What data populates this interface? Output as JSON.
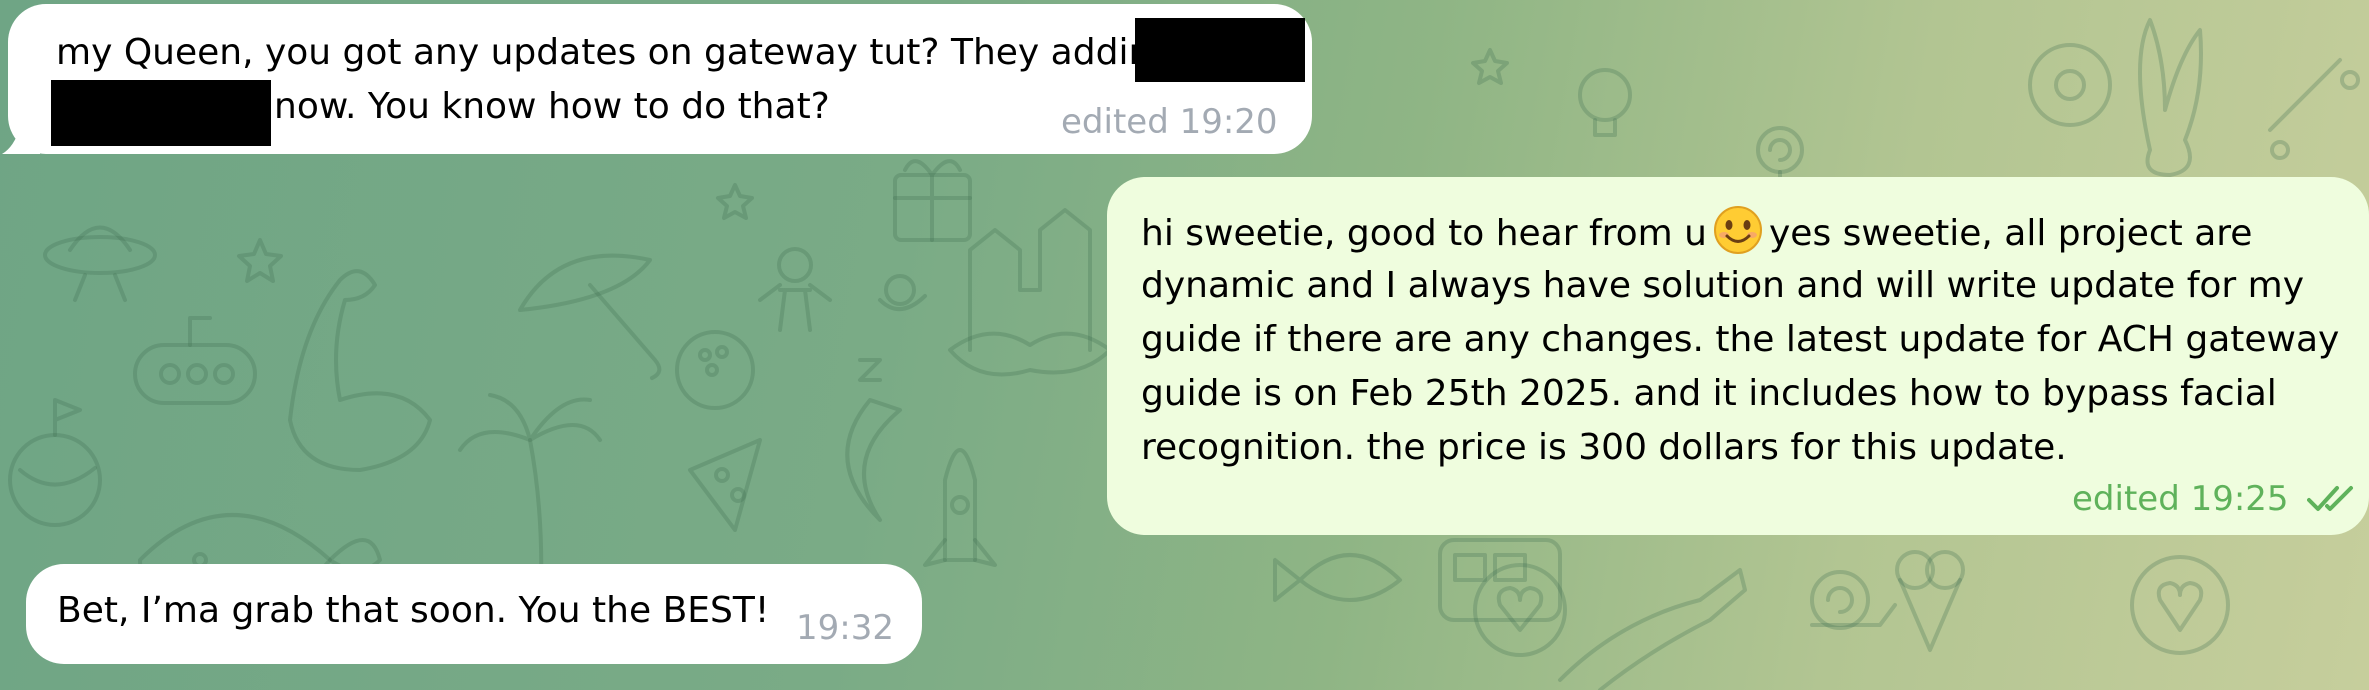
{
  "chat": {
    "messages": [
      {
        "direction": "incoming",
        "lines": [
          "my Queen, you got any updates on gateway tut? They addin",
          "now. You know how to do that?"
        ],
        "meta": "edited 19:20"
      },
      {
        "direction": "outgoing",
        "lines": [
          "hi sweetie, good to hear from u",
          "yes sweetie, all project are",
          "dynamic and I always have solution and will write update for my",
          "guide if there are any changes. the latest update for ACH gateway",
          "guide is on Feb 25th 2025. and it includes how to bypass facial",
          "recognition. the price is 300 dollars for this update."
        ],
        "emoji": "smiling-face-emoji",
        "meta": "edited 19:25",
        "status": "double-check-read"
      },
      {
        "direction": "incoming",
        "lines": [
          "Bet, I’ma grab that soon. You the BEST!"
        ],
        "meta": "19:32"
      }
    ]
  },
  "colors": {
    "incoming_bubble": "#ffffff",
    "outgoing_bubble": "#effdde",
    "incoming_meta": "#a3aab3",
    "outgoing_meta": "#5fb25b",
    "background_left": "#6fa585",
    "background_right": "#c6ce9c"
  }
}
